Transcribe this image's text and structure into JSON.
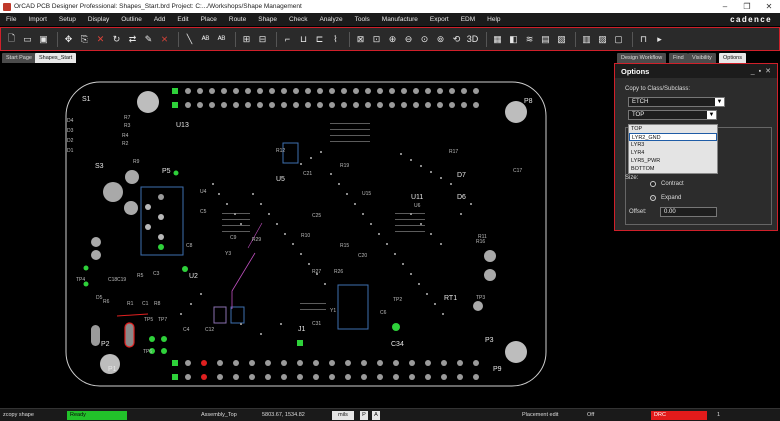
{
  "window": {
    "title": "OrCAD PCB Designer Professional: Shapes_Start.brd  Project: C:.../Workshops/Shape Management",
    "controls": [
      "–",
      "❐",
      "✕"
    ]
  },
  "menu": {
    "items": [
      "File",
      "Import",
      "Setup",
      "Display",
      "Outline",
      "Add",
      "Edit",
      "Place",
      "Route",
      "Shape",
      "Check",
      "Analyze",
      "Tools",
      "Manufacture",
      "Export",
      "EDM",
      "Help"
    ],
    "brand": "cadence"
  },
  "tabs": {
    "start_page": "Start Page",
    "shapes_start": "Shapes_Start",
    "design_workflow": "Design Workflow",
    "find": "Find",
    "visibility": "Visibility",
    "options": "Options"
  },
  "board": {
    "refdes": [
      "S1",
      "P8",
      "U13",
      "D4",
      "D3",
      "D2",
      "D1",
      "R7",
      "R3",
      "C3",
      "P5",
      "S3",
      "U5",
      "R19",
      "C21",
      "D7",
      "U11",
      "D6",
      "C17",
      "U2",
      "Y3",
      "R27",
      "R11",
      "TP4",
      "TP2",
      "RT1",
      "TP3",
      "TP5",
      "TP7",
      "C4",
      "C12",
      "C31",
      "Y1",
      "C6",
      "C34",
      "J1",
      "P1",
      "P2",
      "P3",
      "P9",
      "TP6",
      "R6",
      "R5",
      "R12",
      "R16",
      "C18",
      "C19",
      "D5",
      "R1",
      "C1",
      "R8",
      "R9",
      "U4",
      "U15",
      "C9",
      "R29",
      "C20",
      "U6",
      "R10",
      "R15",
      "R17",
      "C5",
      "C25",
      "R26",
      "R4",
      "R2",
      "C8"
    ]
  },
  "options_panel": {
    "title": "Options",
    "header_controls": [
      "_",
      "▪",
      "✕"
    ],
    "copy_to_label": "Copy to Class/Subclass:",
    "class_value": "ETCH",
    "subclass_value": "TOP",
    "subclass_options": [
      "TOP",
      "LYR2_GND",
      "LYR3",
      "LYR4",
      "LYR5_PWR",
      "BOTTOM"
    ],
    "selected_option_index": 1,
    "size_label": "Size:",
    "contract_label": "Contract",
    "expand_label": "Expand",
    "size_mode": "Expand",
    "offset_label": "Offset:",
    "offset_value": "0.00"
  },
  "statusbar": {
    "command": "zcopy shape",
    "state": "Ready",
    "subclass": "Assembly_Top",
    "coords": "5803.67, 1534.82",
    "units": "mils",
    "p_label": "P",
    "a_label": "A",
    "mode": "Placement edit",
    "off": "Off",
    "drc": "DRC",
    "drc_count": "1"
  },
  "colors": {
    "highlight_red": "#d0202a",
    "ready_green": "#22c22a",
    "pad_green": "#2ed13a",
    "pad_red": "#e02020",
    "pad_grey": "#9a9a9a"
  }
}
